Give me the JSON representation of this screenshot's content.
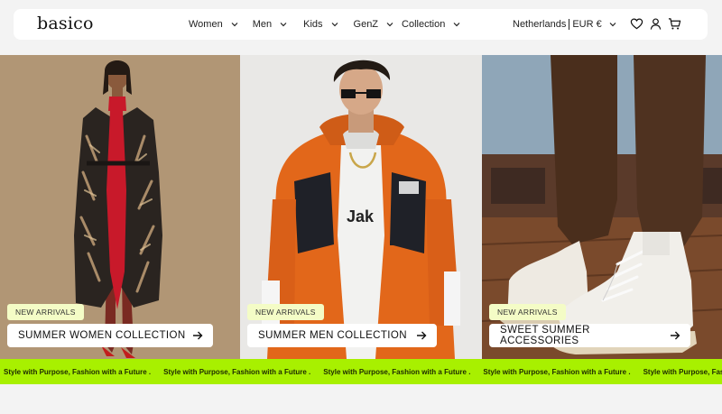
{
  "header": {
    "logo": "basico",
    "nav": [
      {
        "label": "Women"
      },
      {
        "label": "Men"
      },
      {
        "label": "Kids"
      },
      {
        "label": "GenZ"
      },
      {
        "label": "Collection"
      }
    ],
    "country": "Netherlands",
    "currency": "EUR €",
    "icons": [
      "heart-icon",
      "user-icon",
      "cart-icon"
    ]
  },
  "panels": [
    {
      "badge": "NEW ARRIVALS",
      "cta": "SUMMER WOMEN COLLECTION"
    },
    {
      "badge": "NEW ARRIVALS",
      "cta": "SUMMER MEN COLLECTION"
    },
    {
      "badge": "NEW ARRIVALS",
      "cta": "SWEET SUMMER ACCESSORIES"
    }
  ],
  "marquee": {
    "text": "Style with Purpose, Fashion with a Future ."
  },
  "colors": {
    "accent": "#a8f000",
    "badge_bg": "#f4fcc6"
  }
}
